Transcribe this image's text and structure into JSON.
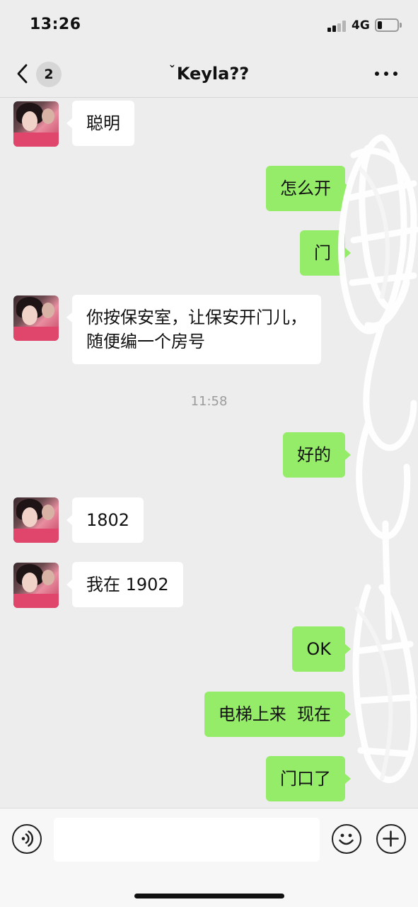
{
  "status_bar": {
    "time": "13:26",
    "network": "4G",
    "battery_level": 0.22
  },
  "nav": {
    "back_badge": "2",
    "title_mark": "ˇ",
    "title": "Keyla",
    "title_suffix": "??"
  },
  "messages": [
    {
      "side": "left",
      "text": "聪明"
    },
    {
      "side": "right",
      "text": "怎么开"
    },
    {
      "side": "right",
      "text": "门"
    },
    {
      "side": "left",
      "text": "你按保安室，让保安开门儿，\n随便编一个房号"
    },
    {
      "side": "time",
      "text": "11:58"
    },
    {
      "side": "right",
      "text": "好的"
    },
    {
      "side": "left",
      "text": "1802"
    },
    {
      "side": "left",
      "text": "我在 1902"
    },
    {
      "side": "right",
      "text": "OK"
    },
    {
      "side": "right",
      "text": "电梯上来  现在"
    },
    {
      "side": "right",
      "text": "门口了"
    }
  ],
  "input": {
    "value": "",
    "placeholder": ""
  },
  "icons": {
    "back": "chevron-left-icon",
    "more": "more-dots-icon",
    "voice": "voice-icon",
    "emoji": "emoji-icon",
    "plus": "plus-icon"
  },
  "colors": {
    "background": "#ededed",
    "outgoing_bubble": "#95ec69",
    "incoming_bubble": "#ffffff",
    "timestamp": "#9b9b9b"
  }
}
